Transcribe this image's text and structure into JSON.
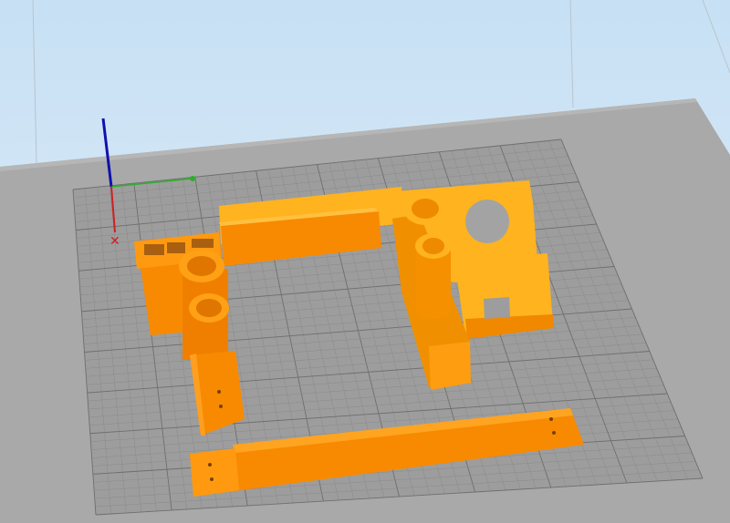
{
  "viewport": {
    "sky_color": "#cfe3f4",
    "plate_color": "#a8a8a8",
    "grid_area_color": "#9c9c9c",
    "part_color": "#f78a00",
    "part_light_color": "#ffb31f",
    "axis_x_color": "#d02020",
    "axis_y_color": "#2ab02a",
    "axis_z_color": "#1010b0",
    "grid_divisions": 40
  }
}
